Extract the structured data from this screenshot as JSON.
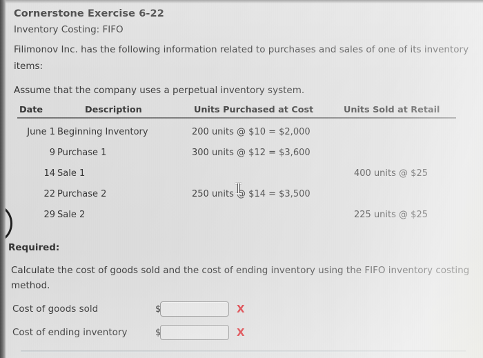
{
  "header": {
    "exercise_title": "Cornerstone Exercise 6-22",
    "exercise_subtitle": "Inventory Costing: FIFO"
  },
  "intro": {
    "line1": "Filimonov Inc. has the following information related to purchases and sales of one of its inventory",
    "line2": "items:",
    "line3": "Assume that the company uses a perpetual inventory system."
  },
  "table": {
    "headers": {
      "date": "Date",
      "description": "Description",
      "units_purchased": "Units Purchased at Cost",
      "units_sold": "Units Sold at Retail"
    },
    "rows": [
      {
        "date": "June 1",
        "description": "Beginning Inventory",
        "units_purchased": "200 units @ $10 = $2,000",
        "units_sold": ""
      },
      {
        "date": "9",
        "description": "Purchase 1",
        "units_purchased": "300 units @ $12 = $3,600",
        "units_sold": ""
      },
      {
        "date": "14",
        "description": "Sale 1",
        "units_purchased": "",
        "units_sold": "400 units @ $25"
      },
      {
        "date": "22",
        "description": "Purchase 2",
        "units_purchased": "250 units @ $14 = $3,500",
        "units_sold": ""
      },
      {
        "date": "29",
        "description": "Sale 2",
        "units_purchased": "",
        "units_sold": "225 units @ $25"
      }
    ]
  },
  "required": {
    "heading": "Required:",
    "instruction_line1": "Calculate the cost of goods sold and the cost of ending inventory using the FIFO inventory costing",
    "instruction_line2": "method."
  },
  "answers": {
    "currency_symbol": "$",
    "incorrect_mark": "X",
    "fields": [
      {
        "label": "Cost of goods sold",
        "value": "",
        "placeholder": ""
      },
      {
        "label": "Cost of ending inventory",
        "value": "",
        "placeholder": ""
      }
    ]
  },
  "colors": {
    "page_background": "#dcdcdc",
    "text": "#2b2b2b",
    "incorrect_mark": "#d8232a",
    "rule": "#5a5a5a"
  }
}
